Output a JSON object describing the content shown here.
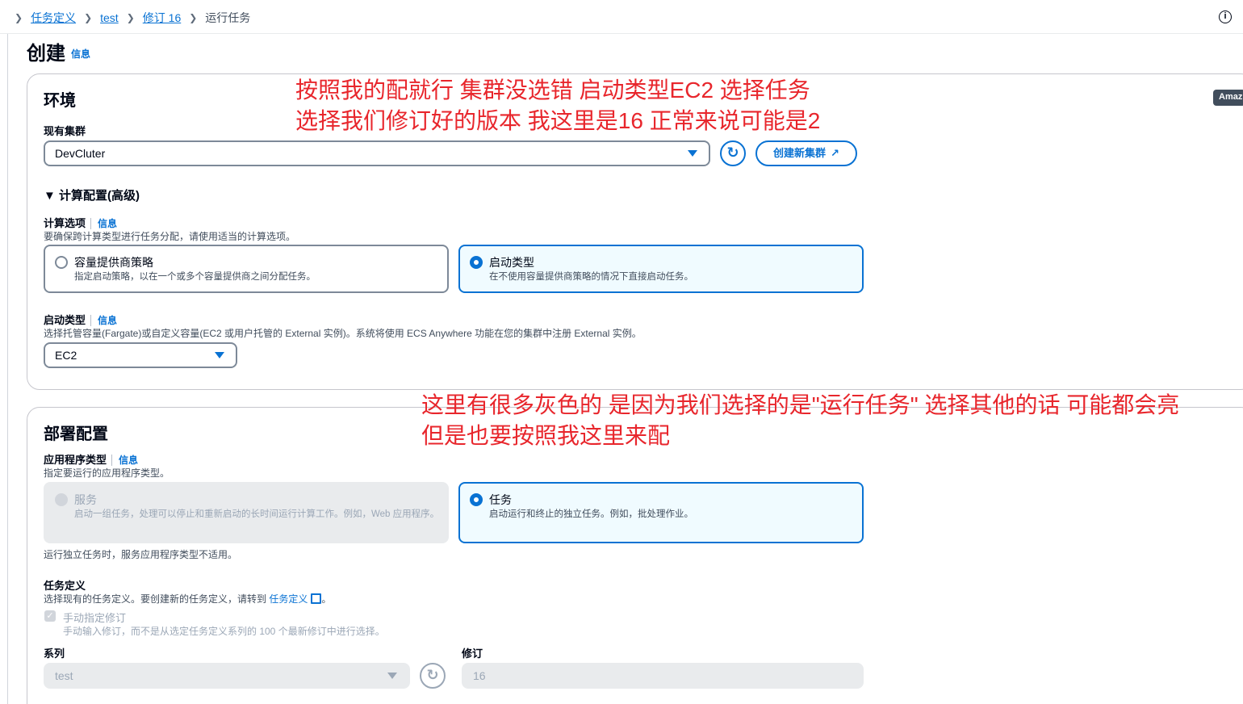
{
  "breadcrumb": {
    "items": [
      "任务定义",
      "test",
      "修订 16"
    ],
    "current": "运行任务"
  },
  "page": {
    "title": "创建",
    "info": "信息"
  },
  "side_badge": "Amaz",
  "environment": {
    "heading": "环境",
    "cluster_label": "现有集群",
    "cluster_value": "DevCluter",
    "create_cluster_button": "创建新集群",
    "compute_section": "计算配置(高级)",
    "compute_options_label": "计算选项",
    "compute_options_info": "信息",
    "compute_options_desc": "要确保跨计算类型进行任务分配，请使用适当的计算选项。",
    "options": [
      {
        "title": "容量提供商策略",
        "desc": "指定启动策略，以在一个或多个容量提供商之间分配任务。",
        "selected": false
      },
      {
        "title": "启动类型",
        "desc": "在不使用容量提供商策略的情况下直接启动任务。",
        "selected": true
      }
    ],
    "launch_type_label": "启动类型",
    "launch_type_info": "信息",
    "launch_type_desc": "选择托管容量(Fargate)或自定义容量(EC2 或用户托管的 External 实例)。系统将使用 ECS Anywhere 功能在您的集群中注册 External 实例。",
    "launch_type_value": "EC2"
  },
  "deployment": {
    "heading": "部署配置",
    "app_type_label": "应用程序类型",
    "app_type_info": "信息",
    "app_type_desc": "指定要运行的应用程序类型。",
    "app_types": [
      {
        "title": "服务",
        "desc": "启动一组任务，处理可以停止和重新启动的长时间运行计算工作。例如，Web 应用程序。",
        "selected": false,
        "disabled": true
      },
      {
        "title": "任务",
        "desc": "启动运行和终止的独立任务。例如，批处理作业。",
        "selected": true,
        "disabled": false
      }
    ],
    "app_type_note": "运行独立任务时，服务应用程序类型不适用。",
    "task_def_label": "任务定义",
    "task_def_desc_prefix": "选择现有的任务定义。要创建新的任务定义，请转到",
    "task_def_link": "任务定义",
    "task_def_desc_suffix": "。",
    "manual_revision_label": "手动指定修订",
    "manual_revision_desc": "手动输入修订，而不是从选定任务定义系列的 100 个最新修订中进行选择。",
    "family_label": "系列",
    "family_value": "test",
    "revision_label": "修订",
    "revision_value": "16"
  },
  "annotations": {
    "top_line1": "按照我的配就行 集群没选错 启动类型EC2 选择任务",
    "top_line2": "选择我们修订好的版本 我这里是16 正常来说可能是2",
    "mid_line1": "这里有很多灰色的 是因为我们选择的是\"运行任务\" 选择其他的话 可能都会亮",
    "mid_line2": "但是也要按照我这里来配"
  },
  "colors": {
    "accent": "#0972d3",
    "annotation": "#e8262c",
    "selected_bg": "#f0fbff",
    "disabled_bg": "#e9ebed"
  }
}
